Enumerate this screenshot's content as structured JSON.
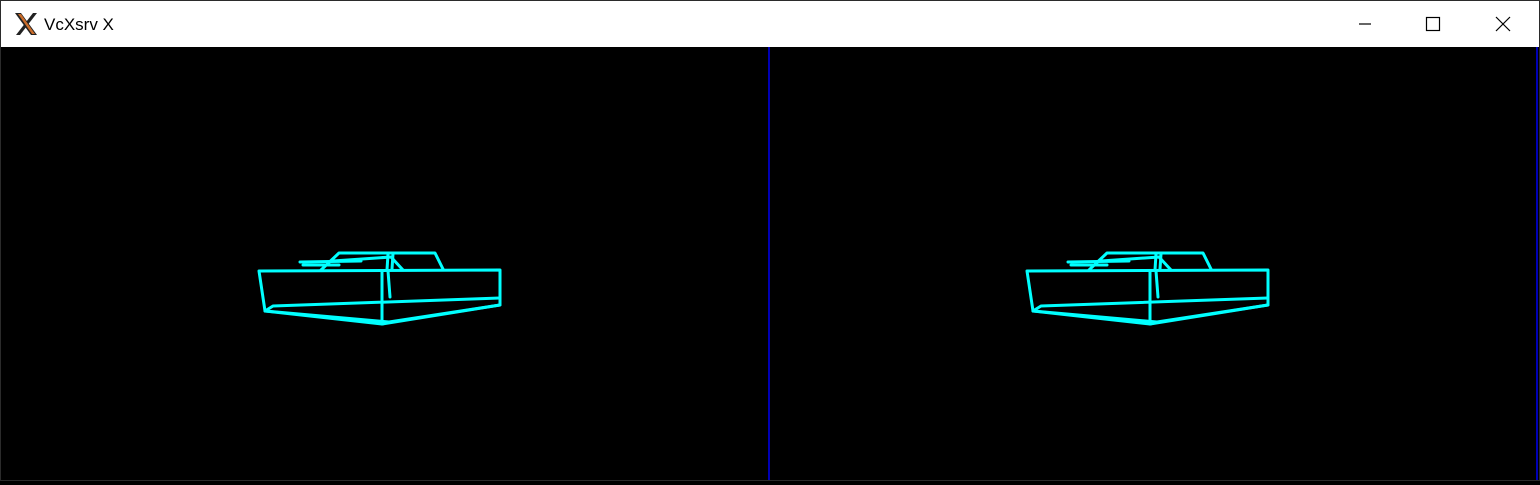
{
  "window": {
    "title": "VcXsrv X",
    "app_icon": "x-logo-icon",
    "controls": [
      {
        "name": "minimize",
        "icon": "minimize-icon"
      },
      {
        "name": "maximize",
        "icon": "maximize-icon"
      },
      {
        "name": "close",
        "icon": "close-icon"
      }
    ]
  },
  "scene": {
    "background_color": "#000000",
    "divider_color": "#0000b4",
    "wireframe_color": "#00ffff",
    "viewports": [
      "left",
      "right"
    ]
  }
}
